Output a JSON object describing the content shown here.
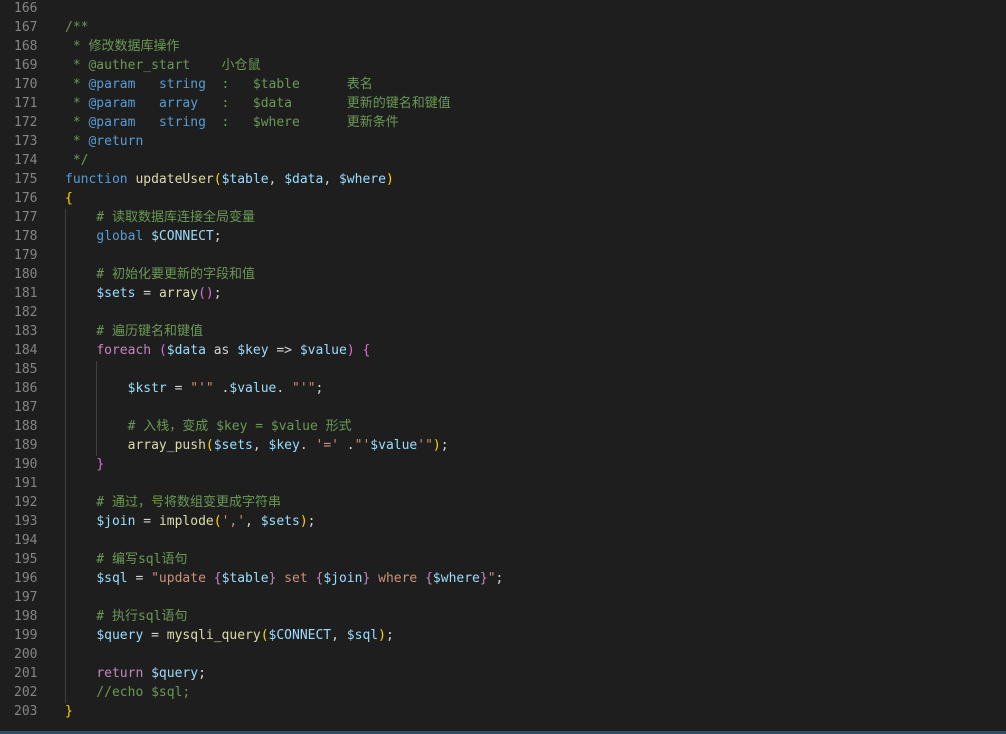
{
  "theme": {
    "background": "#1e1e1e",
    "line_number": "#858585",
    "comment": "#6a9955",
    "keyword": "#569cd6",
    "control": "#c586c0",
    "function": "#dcdcaa",
    "variable": "#9cdcfe",
    "string": "#ce9178",
    "text": "#d4d4d4"
  },
  "lines": [
    {
      "num": "166",
      "tokens": []
    },
    {
      "num": "167",
      "tokens": [
        {
          "t": "/**",
          "c": "t-comment"
        }
      ]
    },
    {
      "num": "168",
      "tokens": [
        {
          "t": " * 修改数据库操作",
          "c": "t-comment"
        }
      ]
    },
    {
      "num": "169",
      "tokens": [
        {
          "t": " * @auther_start    小仓鼠",
          "c": "t-comment"
        }
      ]
    },
    {
      "num": "170",
      "tokens": [
        {
          "t": " * ",
          "c": "t-comment"
        },
        {
          "t": "@param",
          "c": "t-docword"
        },
        {
          "t": "   ",
          "c": "t-comment"
        },
        {
          "t": "string",
          "c": "t-docword"
        },
        {
          "t": "  :   ",
          "c": "t-comment"
        },
        {
          "t": "$table",
          "c": "t-comment"
        },
        {
          "t": "      表名",
          "c": "t-comment"
        }
      ]
    },
    {
      "num": "171",
      "tokens": [
        {
          "t": " * ",
          "c": "t-comment"
        },
        {
          "t": "@param",
          "c": "t-docword"
        },
        {
          "t": "   ",
          "c": "t-comment"
        },
        {
          "t": "array",
          "c": "t-docword"
        },
        {
          "t": "   :   ",
          "c": "t-comment"
        },
        {
          "t": "$data",
          "c": "t-comment"
        },
        {
          "t": "       更新的键名和键值",
          "c": "t-comment"
        }
      ]
    },
    {
      "num": "172",
      "tokens": [
        {
          "t": " * ",
          "c": "t-comment"
        },
        {
          "t": "@param",
          "c": "t-docword"
        },
        {
          "t": "   ",
          "c": "t-comment"
        },
        {
          "t": "string",
          "c": "t-docword"
        },
        {
          "t": "  :   ",
          "c": "t-comment"
        },
        {
          "t": "$where",
          "c": "t-comment"
        },
        {
          "t": "      更新条件",
          "c": "t-comment"
        }
      ]
    },
    {
      "num": "173",
      "tokens": [
        {
          "t": " * ",
          "c": "t-comment"
        },
        {
          "t": "@return",
          "c": "t-docword"
        }
      ]
    },
    {
      "num": "174",
      "tokens": [
        {
          "t": " */",
          "c": "t-comment"
        }
      ]
    },
    {
      "num": "175",
      "tokens": [
        {
          "t": "function",
          "c": "t-keyword"
        },
        {
          "t": " ",
          "c": "t-plain"
        },
        {
          "t": "updateUser",
          "c": "t-func"
        },
        {
          "t": "(",
          "c": "t-paren"
        },
        {
          "t": "$table",
          "c": "t-var"
        },
        {
          "t": ", ",
          "c": "t-punct"
        },
        {
          "t": "$data",
          "c": "t-var"
        },
        {
          "t": ", ",
          "c": "t-punct"
        },
        {
          "t": "$where",
          "c": "t-var"
        },
        {
          "t": ")",
          "c": "t-paren"
        }
      ]
    },
    {
      "num": "176",
      "tokens": [
        {
          "t": "{",
          "c": "t-brace-outer"
        }
      ]
    },
    {
      "num": "177",
      "tokens": [
        {
          "t": "    # 读取数据库连接全局变量",
          "c": "t-comment"
        }
      ]
    },
    {
      "num": "178",
      "tokens": [
        {
          "t": "    ",
          "c": "t-plain"
        },
        {
          "t": "global",
          "c": "t-keyword"
        },
        {
          "t": " ",
          "c": "t-plain"
        },
        {
          "t": "$CONNECT",
          "c": "t-var"
        },
        {
          "t": ";",
          "c": "t-punct"
        }
      ]
    },
    {
      "num": "179",
      "tokens": []
    },
    {
      "num": "180",
      "tokens": [
        {
          "t": "    # 初始化要更新的字段和值",
          "c": "t-comment"
        }
      ]
    },
    {
      "num": "181",
      "tokens": [
        {
          "t": "    ",
          "c": "t-plain"
        },
        {
          "t": "$sets",
          "c": "t-var"
        },
        {
          "t": " = ",
          "c": "t-punct"
        },
        {
          "t": "array",
          "c": "t-func"
        },
        {
          "t": "()",
          "c": "t-brace-inner"
        },
        {
          "t": ";",
          "c": "t-punct"
        }
      ]
    },
    {
      "num": "182",
      "tokens": []
    },
    {
      "num": "183",
      "tokens": [
        {
          "t": "    # 遍历键名和键值",
          "c": "t-comment"
        }
      ]
    },
    {
      "num": "184",
      "tokens": [
        {
          "t": "    ",
          "c": "t-plain"
        },
        {
          "t": "foreach",
          "c": "t-control"
        },
        {
          "t": " ",
          "c": "t-plain"
        },
        {
          "t": "(",
          "c": "t-brace-inner"
        },
        {
          "t": "$data",
          "c": "t-var"
        },
        {
          "t": " as ",
          "c": "t-punct"
        },
        {
          "t": "$key",
          "c": "t-var"
        },
        {
          "t": " => ",
          "c": "t-punct"
        },
        {
          "t": "$value",
          "c": "t-var"
        },
        {
          "t": ")",
          "c": "t-brace-inner"
        },
        {
          "t": " ",
          "c": "t-plain"
        },
        {
          "t": "{",
          "c": "t-brace-inner"
        }
      ]
    },
    {
      "num": "185",
      "tokens": []
    },
    {
      "num": "186",
      "tokens": [
        {
          "t": "        ",
          "c": "t-plain"
        },
        {
          "t": "$kstr",
          "c": "t-var"
        },
        {
          "t": " = ",
          "c": "t-punct"
        },
        {
          "t": "\"'\"",
          "c": "t-string"
        },
        {
          "t": " .",
          "c": "t-punct"
        },
        {
          "t": "$value",
          "c": "t-var"
        },
        {
          "t": ". ",
          "c": "t-punct"
        },
        {
          "t": "\"'\"",
          "c": "t-string"
        },
        {
          "t": ";",
          "c": "t-punct"
        }
      ]
    },
    {
      "num": "187",
      "tokens": []
    },
    {
      "num": "188",
      "tokens": [
        {
          "t": "        # 入栈，变成 $key = $value 形式",
          "c": "t-comment"
        }
      ]
    },
    {
      "num": "189",
      "tokens": [
        {
          "t": "        ",
          "c": "t-plain"
        },
        {
          "t": "array_push",
          "c": "t-func"
        },
        {
          "t": "(",
          "c": "t-paren"
        },
        {
          "t": "$sets",
          "c": "t-var"
        },
        {
          "t": ", ",
          "c": "t-punct"
        },
        {
          "t": "$key",
          "c": "t-var"
        },
        {
          "t": ". ",
          "c": "t-punct"
        },
        {
          "t": "'='",
          "c": "t-string"
        },
        {
          "t": " .",
          "c": "t-punct"
        },
        {
          "t": "\"'",
          "c": "t-string"
        },
        {
          "t": "$value",
          "c": "t-var"
        },
        {
          "t": "'\"",
          "c": "t-string"
        },
        {
          "t": ")",
          "c": "t-paren"
        },
        {
          "t": ";",
          "c": "t-punct"
        }
      ]
    },
    {
      "num": "190",
      "tokens": [
        {
          "t": "    ",
          "c": "t-plain"
        },
        {
          "t": "}",
          "c": "t-brace-inner"
        }
      ]
    },
    {
      "num": "191",
      "tokens": []
    },
    {
      "num": "192",
      "tokens": [
        {
          "t": "    # 通过，号将数组变更成字符串",
          "c": "t-comment"
        }
      ]
    },
    {
      "num": "193",
      "tokens": [
        {
          "t": "    ",
          "c": "t-plain"
        },
        {
          "t": "$join",
          "c": "t-var"
        },
        {
          "t": " = ",
          "c": "t-punct"
        },
        {
          "t": "implode",
          "c": "t-func"
        },
        {
          "t": "(",
          "c": "t-paren"
        },
        {
          "t": "','",
          "c": "t-string"
        },
        {
          "t": ", ",
          "c": "t-punct"
        },
        {
          "t": "$sets",
          "c": "t-var"
        },
        {
          "t": ")",
          "c": "t-paren"
        },
        {
          "t": ";",
          "c": "t-punct"
        }
      ]
    },
    {
      "num": "194",
      "tokens": []
    },
    {
      "num": "195",
      "tokens": [
        {
          "t": "    # 编写sql语句",
          "c": "t-comment"
        }
      ]
    },
    {
      "num": "196",
      "tokens": [
        {
          "t": "    ",
          "c": "t-plain"
        },
        {
          "t": "$sql",
          "c": "t-var"
        },
        {
          "t": " = ",
          "c": "t-punct"
        },
        {
          "t": "\"update ",
          "c": "t-string"
        },
        {
          "t": "{",
          "c": "t-control"
        },
        {
          "t": "$table",
          "c": "t-var"
        },
        {
          "t": "}",
          "c": "t-control"
        },
        {
          "t": " set ",
          "c": "t-string"
        },
        {
          "t": "{",
          "c": "t-control"
        },
        {
          "t": "$join",
          "c": "t-var"
        },
        {
          "t": "}",
          "c": "t-control"
        },
        {
          "t": " where ",
          "c": "t-string"
        },
        {
          "t": "{",
          "c": "t-control"
        },
        {
          "t": "$where",
          "c": "t-var"
        },
        {
          "t": "}",
          "c": "t-control"
        },
        {
          "t": "\"",
          "c": "t-string"
        },
        {
          "t": ";",
          "c": "t-punct"
        }
      ]
    },
    {
      "num": "197",
      "tokens": []
    },
    {
      "num": "198",
      "tokens": [
        {
          "t": "    # 执行sql语句",
          "c": "t-comment"
        }
      ]
    },
    {
      "num": "199",
      "tokens": [
        {
          "t": "    ",
          "c": "t-plain"
        },
        {
          "t": "$query",
          "c": "t-var"
        },
        {
          "t": " = ",
          "c": "t-punct"
        },
        {
          "t": "mysqli_query",
          "c": "t-func"
        },
        {
          "t": "(",
          "c": "t-paren"
        },
        {
          "t": "$CONNECT",
          "c": "t-var"
        },
        {
          "t": ", ",
          "c": "t-punct"
        },
        {
          "t": "$sql",
          "c": "t-var"
        },
        {
          "t": ")",
          "c": "t-paren"
        },
        {
          "t": ";",
          "c": "t-punct"
        }
      ]
    },
    {
      "num": "200",
      "tokens": []
    },
    {
      "num": "201",
      "tokens": [
        {
          "t": "    ",
          "c": "t-plain"
        },
        {
          "t": "return",
          "c": "t-control"
        },
        {
          "t": " ",
          "c": "t-plain"
        },
        {
          "t": "$query",
          "c": "t-var"
        },
        {
          "t": ";",
          "c": "t-punct"
        }
      ]
    },
    {
      "num": "202",
      "tokens": [
        {
          "t": "    //echo $sql;",
          "c": "t-comment"
        }
      ]
    },
    {
      "num": "203",
      "tokens": [
        {
          "t": "}",
          "c": "t-brace-outer"
        }
      ]
    }
  ]
}
